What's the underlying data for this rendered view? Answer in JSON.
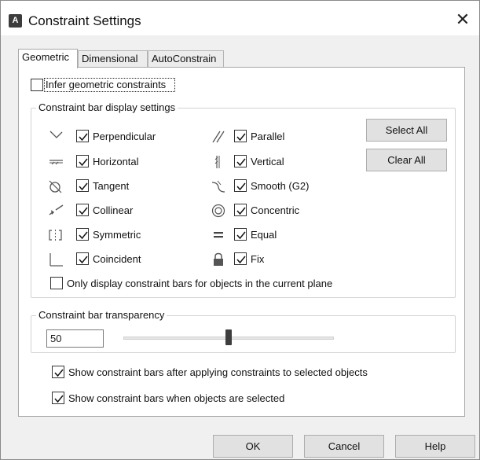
{
  "window": {
    "title": "Constraint Settings",
    "app_icon_letter": "A",
    "close_glyph": "✕"
  },
  "tabs": [
    {
      "label": "Geometric",
      "active": true
    },
    {
      "label": "Dimensional",
      "active": false
    },
    {
      "label": "AutoConstrain",
      "active": false
    }
  ],
  "infer": {
    "label": "Infer geometric constraints",
    "checked": false
  },
  "display_group": {
    "title": "Constraint bar display settings",
    "left_items": [
      {
        "label": "Perpendicular",
        "icon": "perpendicular-icon",
        "checked": true
      },
      {
        "label": "Horizontal",
        "icon": "horizontal-icon",
        "checked": true
      },
      {
        "label": "Tangent",
        "icon": "tangent-icon",
        "checked": true
      },
      {
        "label": "Collinear",
        "icon": "collinear-icon",
        "checked": true
      },
      {
        "label": "Symmetric",
        "icon": "symmetric-icon",
        "checked": true
      },
      {
        "label": "Coincident",
        "icon": "coincident-icon",
        "checked": true
      }
    ],
    "right_items": [
      {
        "label": "Parallel",
        "icon": "parallel-icon",
        "checked": true
      },
      {
        "label": "Vertical",
        "icon": "vertical-icon",
        "checked": true
      },
      {
        "label": "Smooth (G2)",
        "icon": "smooth-icon",
        "checked": true
      },
      {
        "label": "Concentric",
        "icon": "concentric-icon",
        "checked": true
      },
      {
        "label": "Equal",
        "icon": "equal-icon",
        "checked": true
      },
      {
        "label": "Fix",
        "icon": "lock-icon",
        "checked": true
      }
    ],
    "select_all_label": "Select All",
    "clear_all_label": "Clear All",
    "only_plane": {
      "label": "Only display constraint bars for objects in the current plane",
      "checked": false
    }
  },
  "transparency": {
    "title": "Constraint bar transparency",
    "value": "50",
    "slider_fraction": 0.5
  },
  "options": [
    {
      "label": "Show constraint bars after applying constraints to selected objects",
      "checked": true
    },
    {
      "label": "Show constraint bars when objects are selected",
      "checked": true
    }
  ],
  "buttons": {
    "ok": "OK",
    "cancel": "Cancel",
    "help": "Help"
  }
}
